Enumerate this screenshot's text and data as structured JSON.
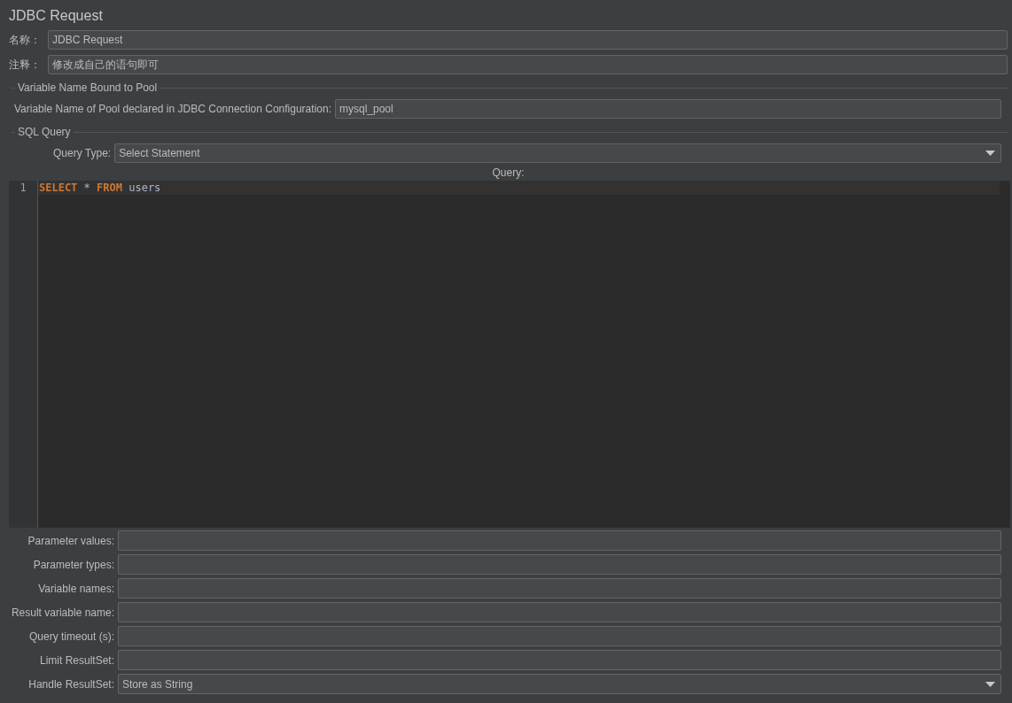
{
  "title": "JDBC Request",
  "name": {
    "label": "名称：",
    "value": "JDBC Request"
  },
  "comment": {
    "label": "注释：",
    "value": "修改成自己的语句即可"
  },
  "pool_section": {
    "title": "Variable Name Bound to Pool",
    "label": "Variable Name of Pool declared in JDBC Connection Configuration:",
    "value": "mysql_pool"
  },
  "sql_section": {
    "title": "SQL Query",
    "query_type": {
      "label": "Query Type:",
      "value": "Select Statement"
    },
    "query_label": "Query:",
    "editor": {
      "lines": [
        {
          "number": "1",
          "tokens": [
            {
              "text": "SELECT",
              "kind": "keyword"
            },
            {
              "text": "*",
              "kind": "operator"
            },
            {
              "text": "FROM",
              "kind": "keyword"
            },
            {
              "text": "users",
              "kind": "plain"
            }
          ]
        }
      ]
    }
  },
  "fields": [
    {
      "label": "Parameter values:",
      "kind": "text"
    },
    {
      "label": "Parameter types:",
      "kind": "text"
    },
    {
      "label": "Variable names:",
      "kind": "text"
    },
    {
      "label": "Result variable name:",
      "kind": "text"
    },
    {
      "label": "Query timeout (s):",
      "kind": "text"
    },
    {
      "label": "Limit ResultSet:",
      "kind": "text"
    },
    {
      "label": "Handle ResultSet:",
      "value": "Store as String",
      "kind": "dropdown"
    }
  ]
}
